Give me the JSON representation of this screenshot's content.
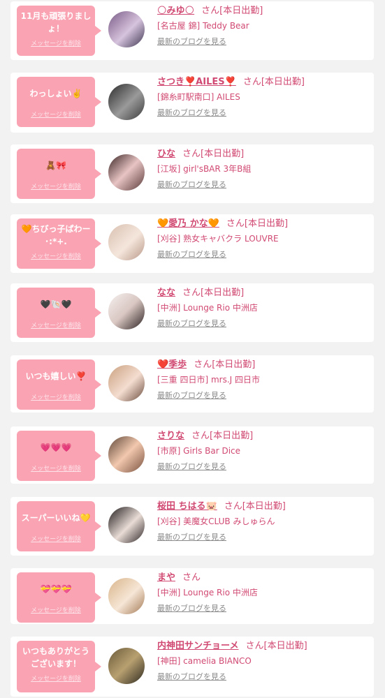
{
  "delete_label": "メッセージを削除",
  "blog_link_label": "最新のブログを見る",
  "honorific": "さん",
  "accent_color": "#d14a73",
  "bubble_color": "#f9a3b3",
  "entries": [
    {
      "message": "11月も頑張りましょ！",
      "name": "🌕みゆ🌕",
      "status": "[本日出勤]",
      "shop": "[名古屋 錦] Teddy Bear"
    },
    {
      "message": "わっしょい✌️",
      "name": "さつき❣️AILES❣️",
      "status": "[本日出勤]",
      "shop": "[錦糸町駅南口] AILES"
    },
    {
      "message": "🧸🎀",
      "name": "ひな",
      "status": "[本日出勤]",
      "shop": "[江坂] girl'sBAR 3年B組"
    },
    {
      "message": "🧡ちびっ子ぱわー ･:*+.",
      "name": "🧡愛乃 かな🧡",
      "status": "[本日出勤]",
      "shop": "[刈谷] 熟女キャバクラ LOUVRE"
    },
    {
      "message": "🖤🐚🖤",
      "name": "なな",
      "status": "[本日出勤]",
      "shop": "[中洲] Lounge Rio 中洲店"
    },
    {
      "message": "いつも嬉しい❣️",
      "name": "❤️季歩",
      "status": "[本日出勤]",
      "shop": "[三重 四日市] mrs.J 四日市"
    },
    {
      "message": "💗💗💗",
      "name": "さりな",
      "status": "[本日出勤]",
      "shop": "[市原] Girls Bar Dice"
    },
    {
      "message": "スーパーいいね💛",
      "name": "桜田 ちはる🐷",
      "status": "[本日出勤]",
      "shop": "[刈谷] 美魔女CLUB みしゅらん"
    },
    {
      "message": "💝💝💝",
      "name": "まや",
      "status": "",
      "shop": "[中洲] Lounge Rio 中洲店"
    },
    {
      "message": "いつもありがとうございます！",
      "name": "内神田サンチョーメ",
      "status": "[本日出勤]",
      "shop": "[神田] camelia BIANCO"
    }
  ]
}
